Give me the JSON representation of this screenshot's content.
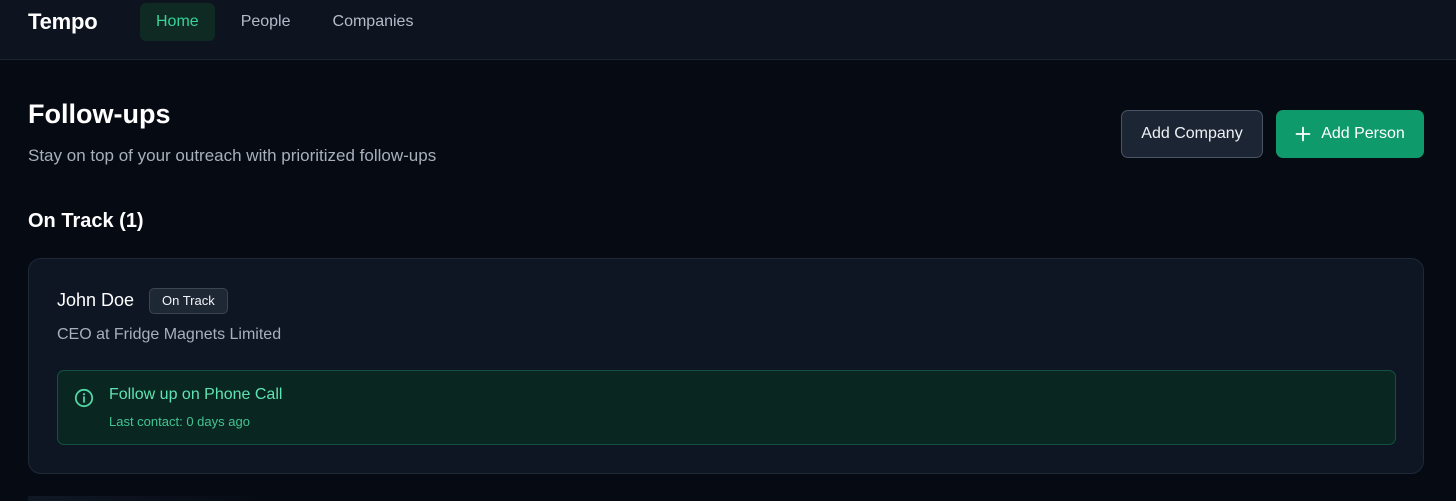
{
  "header": {
    "brand": "Tempo",
    "nav": [
      {
        "label": "Home",
        "active": true
      },
      {
        "label": "People",
        "active": false
      },
      {
        "label": "Companies",
        "active": false
      }
    ]
  },
  "page": {
    "title": "Follow-ups",
    "subtitle": "Stay on top of your outreach with prioritized follow-ups",
    "actions": {
      "add_company": "Add Company",
      "add_person": "Add Person",
      "add_person_icon": "plus-icon"
    }
  },
  "section": {
    "title": "On Track (1)",
    "items": [
      {
        "name": "John Doe",
        "status": "On Track",
        "role": "CEO at Fridge Magnets Limited",
        "followup": {
          "icon": "info-icon",
          "title": "Follow up on Phone Call",
          "meta": "Last contact: 0 days ago"
        }
      }
    ]
  },
  "colors": {
    "background": "#060a13",
    "surface": "#0e1624",
    "accent": "#0f9a6c",
    "accent_text": "#35d49a",
    "alert_bg": "#0a2620"
  }
}
